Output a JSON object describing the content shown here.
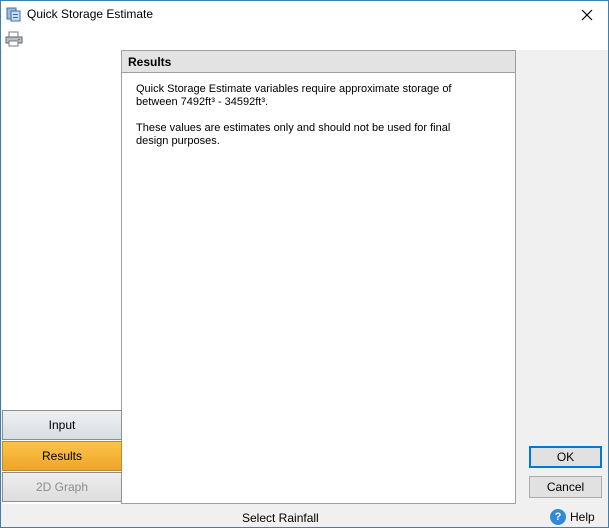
{
  "window": {
    "title": "Quick Storage Estimate"
  },
  "toolbar": {
    "print_icon": "printer-icon"
  },
  "nav": {
    "items": [
      {
        "label": "Input",
        "state": "normal"
      },
      {
        "label": "Results",
        "state": "selected"
      },
      {
        "label": "2D Graph",
        "state": "disabled"
      }
    ]
  },
  "panel": {
    "header": "Results",
    "paragraph1": "Quick Storage Estimate variables require approximate storage of between 7492ft³ - 34592ft³.",
    "paragraph2": "These values are estimates only and should not be used for final design purposes."
  },
  "buttons": {
    "ok": "OK",
    "cancel": "Cancel"
  },
  "status": {
    "text": "Select Rainfall",
    "help": "Help"
  },
  "colors": {
    "selected": "#f0a42a",
    "accent": "#0078d7"
  }
}
